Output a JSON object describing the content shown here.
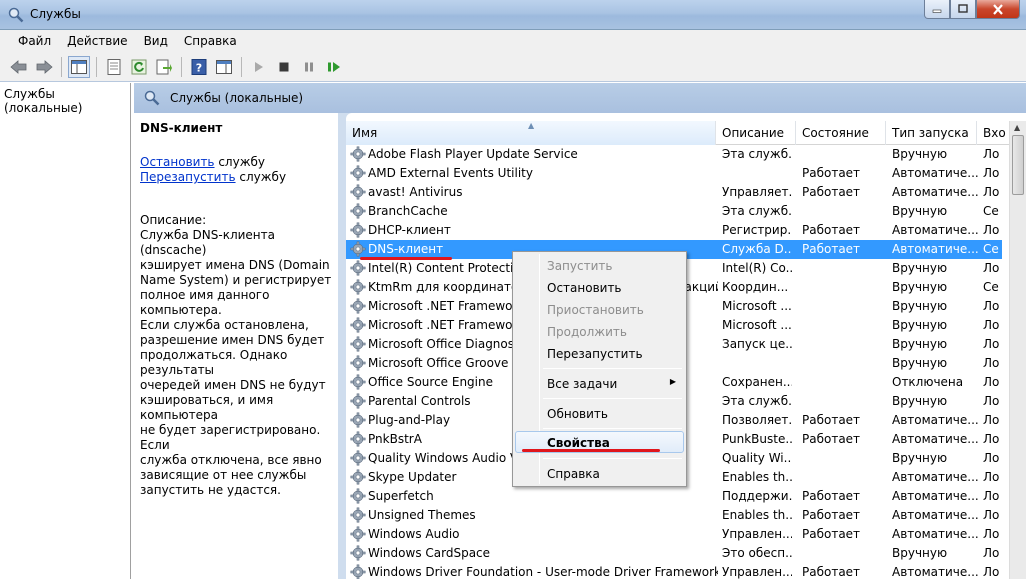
{
  "window": {
    "title": "Службы"
  },
  "menu": [
    "Файл",
    "Действие",
    "Вид",
    "Справка"
  ],
  "tree": {
    "root_label": "Службы (локальные)"
  },
  "pane_header": {
    "label": "Службы (локальные)"
  },
  "details": {
    "service_name": "DNS-клиент",
    "stop_link": "Остановить",
    "stop_suffix": " службу",
    "restart_link": "Перезапустить",
    "restart_suffix": " службу",
    "description_label": "Описание:",
    "description": "Служба DNS-клиента (dnscache)\nкэширует имена DNS (Domain\nName System) и регистрирует\nполное имя данного компьютера.\nЕсли служба остановлена,\nразрешение имен DNS будет\nпродолжаться. Однако результаты\nочередей имен DNS не будут\nкэшироваться, и имя компьютера\nне будет зарегистрировано. Если\nслужба отключена, все явно\nзависящие от нее службы\nзапустить не удастся."
  },
  "columns": {
    "name": "Имя",
    "description": "Описание",
    "state": "Состояние",
    "startup": "Тип запуска",
    "logon": "Вхо"
  },
  "services": [
    {
      "name": "Adobe Flash Player Update Service",
      "desc": "Эта служб...",
      "state": "",
      "startup": "Вручную",
      "logon": "Ло"
    },
    {
      "name": "AMD External Events Utility",
      "desc": "",
      "state": "Работает",
      "startup": "Автоматиче...",
      "logon": "Ло"
    },
    {
      "name": "avast! Antivirus",
      "desc": "Управляет...",
      "state": "Работает",
      "startup": "Автоматиче...",
      "logon": "Ло"
    },
    {
      "name": "BranchCache",
      "desc": "Эта служб...",
      "state": "",
      "startup": "Вручную",
      "logon": "Се"
    },
    {
      "name": "DHCP-клиент",
      "desc": "Регистрир...",
      "state": "Работает",
      "startup": "Автоматиче...",
      "logon": "Ло"
    },
    {
      "name": "DNS-клиент",
      "desc": "Служба D...",
      "state": "Работает",
      "startup": "Автоматиче...",
      "logon": "Се"
    },
    {
      "name": "Intel(R) Content Protection HECI Service",
      "desc": "Intel(R) Co...",
      "state": "",
      "startup": "Вручную",
      "logon": "Ло"
    },
    {
      "name": "KtmRm для координатора распределенных транзакций",
      "desc": "Координ...",
      "state": "",
      "startup": "Вручную",
      "logon": "Се"
    },
    {
      "name": "Microsoft .NET Framework NGEN v2.0.50727_X86",
      "desc": "Microsoft ...",
      "state": "",
      "startup": "Вручную",
      "logon": "Ло"
    },
    {
      "name": "Microsoft .NET Framework NGEN v4.0.30319_X86",
      "desc": "Microsoft ...",
      "state": "",
      "startup": "Вручную",
      "logon": "Ло"
    },
    {
      "name": "Microsoft Office Diagnostics Service",
      "desc": "Запуск це...",
      "state": "",
      "startup": "Вручную",
      "logon": "Ло"
    },
    {
      "name": "Microsoft Office Groove Audit Service",
      "desc": "",
      "state": "",
      "startup": "Вручную",
      "logon": "Ло"
    },
    {
      "name": "Office Source Engine",
      "desc": "Сохранен...",
      "state": "",
      "startup": "Отключена",
      "logon": "Ло"
    },
    {
      "name": "Parental Controls",
      "desc": "Эта служб...",
      "state": "",
      "startup": "Вручную",
      "logon": "Ло"
    },
    {
      "name": "Plug-and-Play",
      "desc": "Позволяет...",
      "state": "Работает",
      "startup": "Автоматиче...",
      "logon": "Ло"
    },
    {
      "name": "PnkBstrA",
      "desc": "PunkBuste...",
      "state": "Работает",
      "startup": "Автоматиче...",
      "logon": "Ло"
    },
    {
      "name": "Quality Windows Audio Video Experience",
      "desc": "Quality Wi...",
      "state": "",
      "startup": "Вручную",
      "logon": "Ло"
    },
    {
      "name": "Skype Updater",
      "desc": "Enables th...",
      "state": "",
      "startup": "Автоматиче...",
      "logon": "Ло"
    },
    {
      "name": "Superfetch",
      "desc": "Поддержи...",
      "state": "Работает",
      "startup": "Автоматиче...",
      "logon": "Ло"
    },
    {
      "name": "Unsigned Themes",
      "desc": "Enables th...",
      "state": "Работает",
      "startup": "Автоматиче...",
      "logon": "Ло"
    },
    {
      "name": "Windows Audio",
      "desc": "Управлен...",
      "state": "Работает",
      "startup": "Автоматиче...",
      "logon": "Ло"
    },
    {
      "name": "Windows CardSpace",
      "desc": "Это обесп...",
      "state": "",
      "startup": "Вручную",
      "logon": "Ло"
    },
    {
      "name": "Windows Driver Foundation - User-mode Driver Framework",
      "desc": "Управлен...",
      "state": "Работает",
      "startup": "Автоматиче...",
      "logon": "Ло"
    }
  ],
  "selected_index": 5,
  "context_menu": {
    "start": "Запустить",
    "stop": "Остановить",
    "pause": "Приостановить",
    "resume": "Продолжить",
    "restart": "Перезапустить",
    "all_tasks": "Все задачи",
    "refresh": "Обновить",
    "properties": "Свойства",
    "help": "Справка"
  },
  "colors": {
    "selection": "#3399ff",
    "annotation": "#e0161c",
    "link": "#0033cc"
  }
}
